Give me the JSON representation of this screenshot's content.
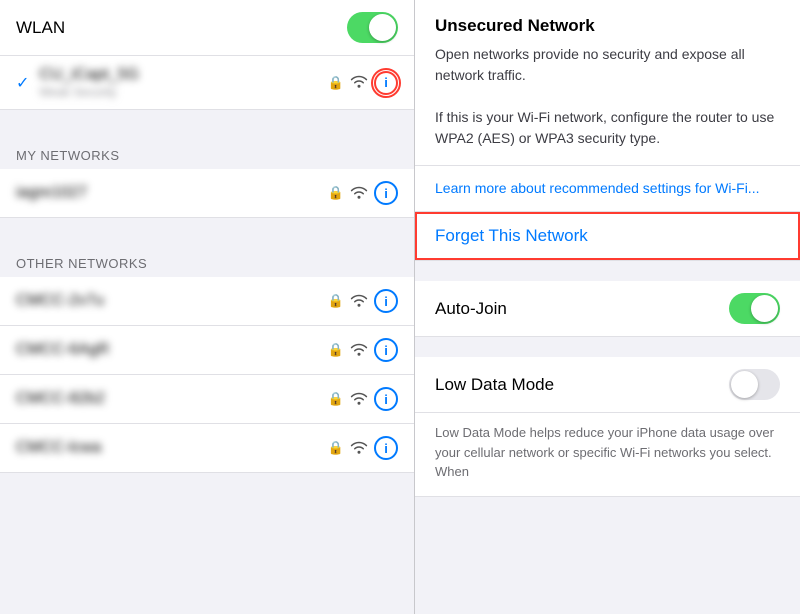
{
  "left": {
    "wlan_label": "WLAN",
    "connected_network": {
      "name": "CU_iCapt_5G",
      "sub": "Weak Security"
    },
    "my_networks_header": "MY NETWORKS",
    "my_networks": [
      {
        "name": "iagre1027",
        "blurred": true
      }
    ],
    "other_networks_header": "OTHER NETWORKS",
    "other_networks": [
      {
        "name": "CMCC-2v7u",
        "blurred": true
      },
      {
        "name": "CMCC-6AgR",
        "blurred": true
      },
      {
        "name": "CMCC-82b2",
        "blurred": true
      },
      {
        "name": "CMCC-lcwa",
        "blurred": true
      }
    ]
  },
  "right": {
    "security_title": "Unsecured Network",
    "security_desc": "Open networks provide no security and expose all network traffic.\n\nIf this is your Wi-Fi network, configure the router to use WPA2 (AES) or WPA3 security type.",
    "learn_more": "Learn more about recommended settings for Wi-Fi...",
    "forget_label": "Forget This Network",
    "auto_join_label": "Auto-Join",
    "low_data_label": "Low Data Mode",
    "low_data_desc": "Low Data Mode helps reduce your iPhone data usage over your cellular network or specific Wi-Fi networks you select. When"
  },
  "icons": {
    "info": "i",
    "lock": "🔒",
    "wifi": "📶",
    "check": "✓"
  }
}
